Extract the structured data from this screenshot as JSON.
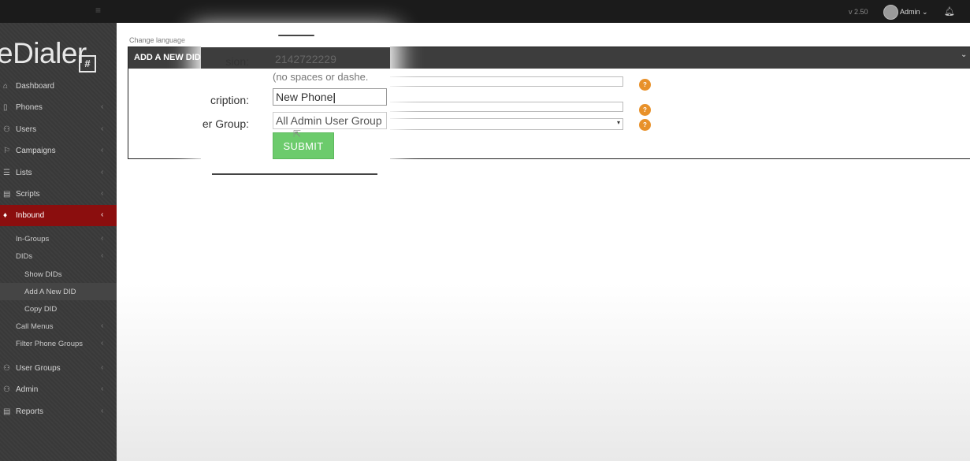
{
  "topbar": {
    "menu_icon": "hamburger-icon",
    "version": "v 2.50",
    "user_label": "Admin ⌄",
    "bell_icon": "bell-icon"
  },
  "logo": {
    "text": "eDialer",
    "box_glyph": "#"
  },
  "sidebar": {
    "items": [
      {
        "label": "Dashboard",
        "icon": "home-icon"
      },
      {
        "label": "Phones",
        "icon": "phone-icon"
      },
      {
        "label": "Users",
        "icon": "user-icon"
      },
      {
        "label": "Campaigns",
        "icon": "flag-icon"
      },
      {
        "label": "Lists",
        "icon": "list-icon"
      },
      {
        "label": "Scripts",
        "icon": "file-icon"
      },
      {
        "label": "Inbound",
        "icon": "diamond-icon"
      },
      {
        "label": "User Groups",
        "icon": "user-group-icon"
      },
      {
        "label": "Admin",
        "icon": "admin-icon"
      },
      {
        "label": "Reports",
        "icon": "report-icon"
      }
    ],
    "inbound_sub": [
      {
        "label": "In-Groups"
      },
      {
        "label": "DIDs"
      },
      {
        "label": "Call Menus"
      },
      {
        "label": "Filter Phone Groups"
      }
    ],
    "did_sub": [
      {
        "label": "Show DIDs"
      },
      {
        "label": "Add A New DID"
      },
      {
        "label": "Copy DID"
      }
    ]
  },
  "content": {
    "change_language": "Change language",
    "panel_title": "ADD A NEW DID",
    "form": {
      "extension_label_visible": "sion:",
      "extension_value": "2142722229",
      "extension_hint": "(no spaces or dashe.",
      "description_label_visible": "cription:",
      "description_value": "New Phone",
      "user_group_label_visible": "er Group:",
      "user_group_value": "All Admin User Group",
      "submit_label": "SUBMIT",
      "help_glyph": "?"
    }
  },
  "colors": {
    "active_nav": "#8b0e0e",
    "submit": "#6ccb6c",
    "help": "#e8912a"
  }
}
